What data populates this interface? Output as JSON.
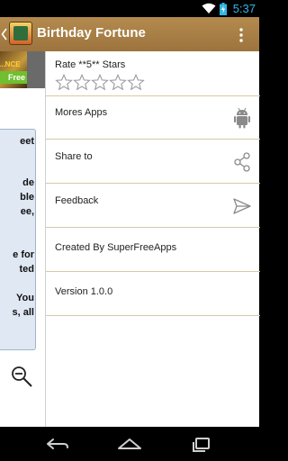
{
  "status_bar": {
    "time": "5:37",
    "wifi_icon": "wifi-icon",
    "battery_icon": "battery-charging-icon"
  },
  "action_bar": {
    "title": "Birthday Fortune",
    "app_icon": "app-icon",
    "overflow_icon": "overflow-menu-icon"
  },
  "background_content": {
    "banner_text": "...NCE",
    "banner_badge": "Free",
    "card_lines": [
      "eet",
      "",
      "de",
      "ble",
      "ee,",
      "",
      "e for",
      "ted",
      "",
      "You",
      "s, all"
    ]
  },
  "drawer": {
    "items": [
      {
        "label": "Rate **5** Stars",
        "icon": "star-rating",
        "stars": 5,
        "rating_filled": 0
      },
      {
        "label": "Mores Apps",
        "icon": "android-icon"
      },
      {
        "label": "Share to",
        "icon": "share-icon"
      },
      {
        "label": "Feedback",
        "icon": "send-icon"
      },
      {
        "label": "Created By SuperFreeApps",
        "icon": ""
      },
      {
        "label": "Version 1.0.0",
        "icon": ""
      }
    ]
  },
  "nav_bar": {
    "back_icon": "back-icon",
    "home_icon": "home-icon",
    "recents_icon": "recents-icon"
  },
  "colors": {
    "action_bar": "#a8803f",
    "divider": "#d8c9a8",
    "status_accent": "#33b5e5"
  }
}
